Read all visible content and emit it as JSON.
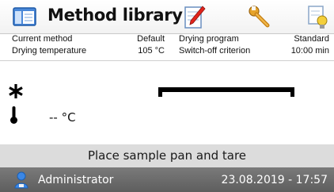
{
  "toolbar": {
    "title": "Method library",
    "icons": [
      "method-library-icon",
      "edit-pencil-icon",
      "wrench-icon",
      "lamp-settings-icon"
    ]
  },
  "info": {
    "current_method_label": "Current method",
    "current_method_value": "Default",
    "drying_program_label": "Drying program",
    "drying_program_value": "Standard",
    "drying_temperature_label": "Drying temperature",
    "drying_temperature_value": "105 °C",
    "switch_off_label": "Switch-off criterion",
    "switch_off_value": "10:00 min"
  },
  "main": {
    "status_symbol": "*",
    "temperature_value": "-- °C"
  },
  "instruction": "Place sample pan and tare",
  "status_bar": {
    "user": "Administrator",
    "datetime": "23.08.2019 - 17:57"
  },
  "colors": {
    "status_bar": "#666666",
    "instruction_bar": "#dcdcdc",
    "accent_blue": "#2a73c9"
  }
}
